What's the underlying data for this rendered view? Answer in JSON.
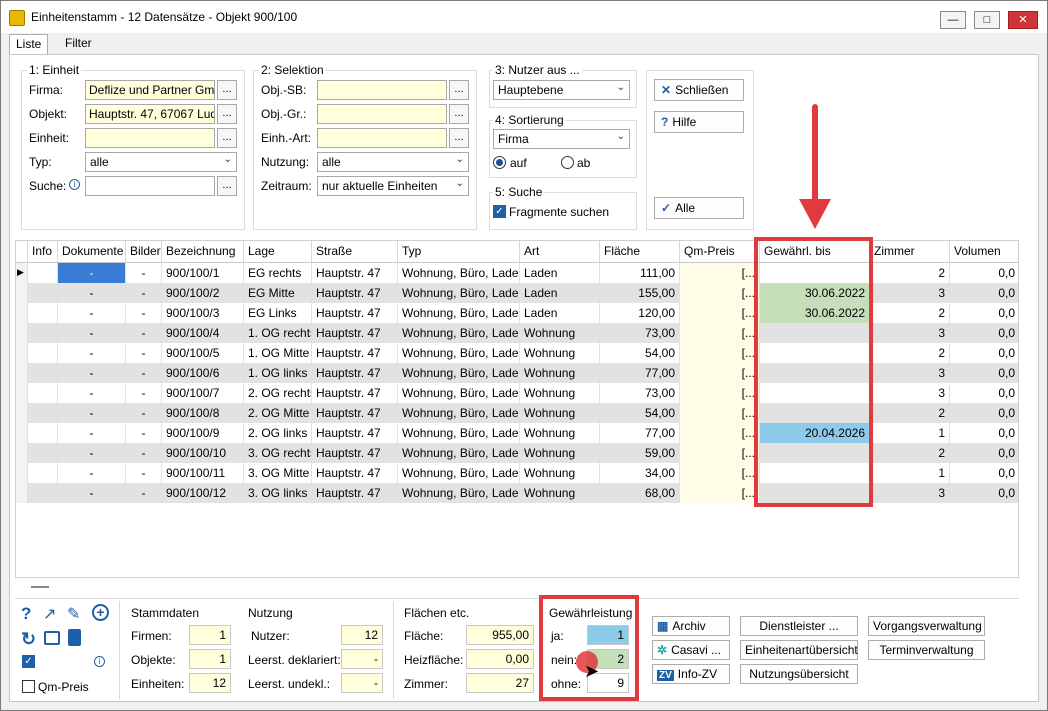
{
  "window": {
    "title": "Einheitenstamm - 12 Datensätze - Objekt 900/100"
  },
  "tabs": [
    {
      "label": "Liste"
    },
    {
      "label": "Filter"
    }
  ],
  "einheit": {
    "group_label": "1: Einheit",
    "firma_label": "Firma:",
    "firma_value": "Deflize und Partner GmI",
    "objekt_label": "Objekt:",
    "objekt_value": "Hauptstr. 47, 67067 Lud",
    "einheit_label": "Einheit:",
    "einheit_value": "",
    "typ_label": "Typ:",
    "typ_value": "alle",
    "suche_label": "Suche:",
    "suche_value": "",
    "dots": "..."
  },
  "selektion": {
    "group_label": "2: Selektion",
    "objsb_label": "Obj.-SB:",
    "objgr_label": "Obj.-Gr.:",
    "einhart_label": "Einh.-Art:",
    "nutzung_label": "Nutzung:",
    "nutzung_value": "alle",
    "zeitraum_label": "Zeitraum:",
    "zeitraum_value": "nur aktuelle Einheiten"
  },
  "nutzer": {
    "group_label": "3: Nutzer aus ...",
    "value": "Hauptebene"
  },
  "sortierung": {
    "group_label": "4: Sortierung",
    "value": "Firma",
    "auf": "auf",
    "ab": "ab"
  },
  "suche": {
    "group_label": "5: Suche",
    "fragmente": "Fragmente suchen"
  },
  "buttons": {
    "schliessen": "Schließen",
    "hilfe": "Hilfe",
    "alle": "Alle"
  },
  "columns": [
    "Info",
    "Dokumente",
    "Bilder",
    "Bezeichnung",
    "Lage",
    "Straße",
    "Typ",
    "Art",
    "Fläche",
    "Qm-Preis",
    "Gewährl. bis",
    "Zimmer",
    "Volumen"
  ],
  "rows": [
    {
      "dok": "-",
      "bilder": "-",
      "bez": "900/100/1",
      "lage": "EG rechts",
      "str": "Hauptstr. 47",
      "typ": "Wohnung, Büro, Laden",
      "art": "Laden",
      "flaeche": "111,00",
      "qm": "[...",
      "gew": "",
      "zimmer": "2",
      "vol": "0,0"
    },
    {
      "dok": "-",
      "bilder": "-",
      "bez": "900/100/2",
      "lage": "EG Mitte",
      "str": "Hauptstr. 47",
      "typ": "Wohnung, Büro, Laden",
      "art": "Laden",
      "flaeche": "155,00",
      "qm": "[...",
      "gew": "30.06.2022",
      "zimmer": "3",
      "vol": "0,0"
    },
    {
      "dok": "-",
      "bilder": "-",
      "bez": "900/100/3",
      "lage": "EG Links",
      "str": "Hauptstr. 47",
      "typ": "Wohnung, Büro, Laden",
      "art": "Laden",
      "flaeche": "120,00",
      "qm": "[...",
      "gew": "30.06.2022",
      "zimmer": "2",
      "vol": "0,0"
    },
    {
      "dok": "-",
      "bilder": "-",
      "bez": "900/100/4",
      "lage": "1. OG rechts",
      "str": "Hauptstr. 47",
      "typ": "Wohnung, Büro, Laden",
      "art": "Wohnung",
      "flaeche": "73,00",
      "qm": "[...",
      "gew": "",
      "zimmer": "3",
      "vol": "0,0"
    },
    {
      "dok": "-",
      "bilder": "-",
      "bez": "900/100/5",
      "lage": "1. OG Mitte",
      "str": "Hauptstr. 47",
      "typ": "Wohnung, Büro, Laden",
      "art": "Wohnung",
      "flaeche": "54,00",
      "qm": "[...",
      "gew": "",
      "zimmer": "2",
      "vol": "0,0"
    },
    {
      "dok": "-",
      "bilder": "-",
      "bez": "900/100/6",
      "lage": "1. OG links",
      "str": "Hauptstr. 47",
      "typ": "Wohnung, Büro, Laden",
      "art": "Wohnung",
      "flaeche": "77,00",
      "qm": "[...",
      "gew": "",
      "zimmer": "3",
      "vol": "0,0"
    },
    {
      "dok": "-",
      "bilder": "-",
      "bez": "900/100/7",
      "lage": "2. OG rechts",
      "str": "Hauptstr. 47",
      "typ": "Wohnung, Büro, Laden",
      "art": "Wohnung",
      "flaeche": "73,00",
      "qm": "[...",
      "gew": "",
      "zimmer": "3",
      "vol": "0,0"
    },
    {
      "dok": "-",
      "bilder": "-",
      "bez": "900/100/8",
      "lage": "2. OG Mitte",
      "str": "Hauptstr. 47",
      "typ": "Wohnung, Büro, Laden",
      "art": "Wohnung",
      "flaeche": "54,00",
      "qm": "[...",
      "gew": "",
      "zimmer": "2",
      "vol": "0,0"
    },
    {
      "dok": "-",
      "bilder": "-",
      "bez": "900/100/9",
      "lage": "2. OG links",
      "str": "Hauptstr. 47",
      "typ": "Wohnung, Büro, Laden",
      "art": "Wohnung",
      "flaeche": "77,00",
      "qm": "[...",
      "gew": "20.04.2026",
      "zimmer": "1",
      "vol": "0,0"
    },
    {
      "dok": "-",
      "bilder": "-",
      "bez": "900/100/10",
      "lage": "3. OG rechts",
      "str": "Hauptstr. 47",
      "typ": "Wohnung, Büro, Laden",
      "art": "Wohnung",
      "flaeche": "59,00",
      "qm": "[...",
      "gew": "",
      "zimmer": "2",
      "vol": "0,0"
    },
    {
      "dok": "-",
      "bilder": "-",
      "bez": "900/100/11",
      "lage": "3. OG Mitte",
      "str": "Hauptstr. 47",
      "typ": "Wohnung, Büro, Laden",
      "art": "Wohnung",
      "flaeche": "34,00",
      "qm": "[...",
      "gew": "",
      "zimmer": "1",
      "vol": "0,0"
    },
    {
      "dok": "-",
      "bilder": "-",
      "bez": "900/100/12",
      "lage": "3. OG links",
      "str": "Hauptstr. 47",
      "typ": "Wohnung, Büro, Laden",
      "art": "Wohnung",
      "flaeche": "68,00",
      "qm": "[...",
      "gew": "",
      "zimmer": "3",
      "vol": "0,0"
    }
  ],
  "stamm": {
    "title": "Stammdaten",
    "firmen_label": "Firmen:",
    "firmen": "1",
    "objekte_label": "Objekte:",
    "objekte": "1",
    "einheiten_label": "Einheiten:",
    "einheiten": "12"
  },
  "nutzung": {
    "title": "Nutzung",
    "nutzer_label": "Nutzer:",
    "nutzer": "12",
    "dekl_label": "Leerst. deklariert:",
    "dekl": "-",
    "undekl_label": "Leerst. undekl.:",
    "undekl": "-"
  },
  "flaechen": {
    "title": "Flächen etc.",
    "flaeche_label": "Fläche:",
    "flaeche": "955,00",
    "heiz_label": "Heizfläche:",
    "heiz": "0,00",
    "zimmer_label": "Zimmer:",
    "zimmer": "27"
  },
  "gewaehr": {
    "title": "Gewährleistung",
    "ja_label": "ja:",
    "ja": "1",
    "nein_label": "nein:",
    "nein": "2",
    "ohne_label": "ohne:",
    "ohne": "9"
  },
  "actions": {
    "archiv": "Archiv",
    "casavi": "Casavi ...",
    "infozv": "Info-ZV",
    "dienstleister": "Dienstleister ...",
    "einheitenart": "Einheitenartübersicht",
    "nutzungsuebersicht": "Nutzungsübersicht",
    "vorgang": "Vorgangsverwaltung",
    "termin": "Terminverwaltung"
  },
  "qmpreis_label": "Qm-Preis",
  "colors": {
    "highlight": "#e0393e",
    "green": "#c5dfba",
    "blue": "#8ecbeb",
    "yellow": "#ffffdc"
  }
}
